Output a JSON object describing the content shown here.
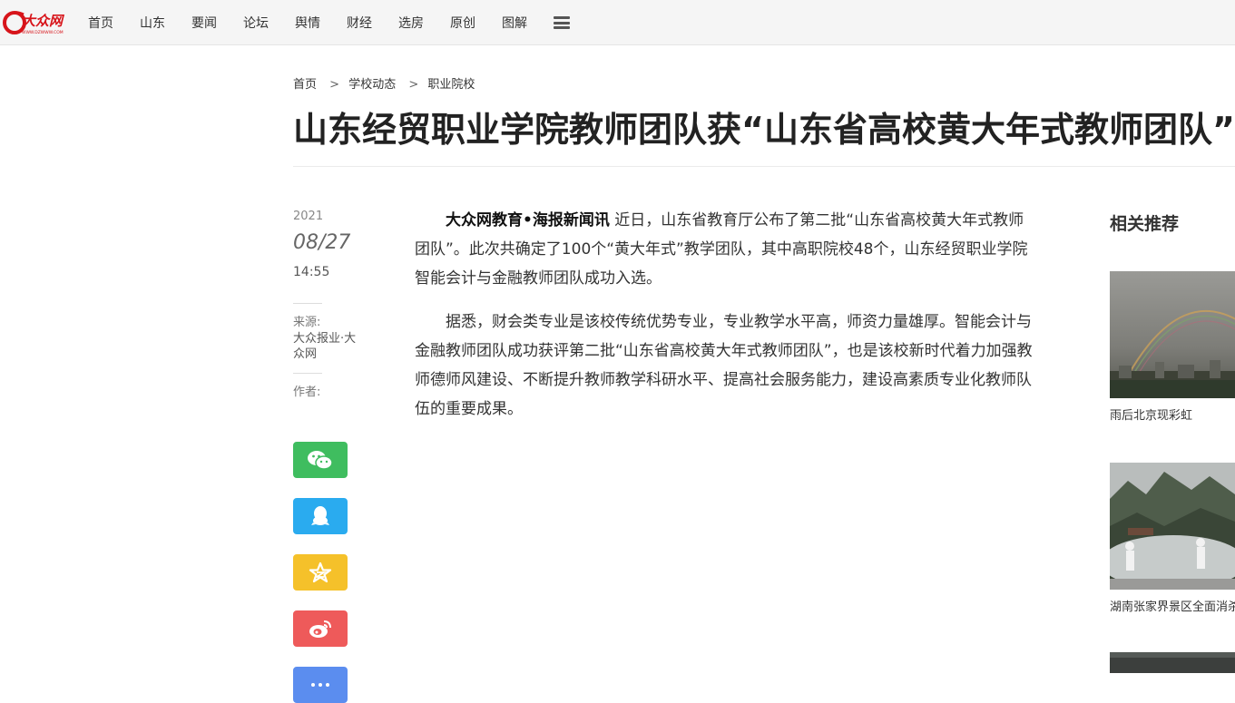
{
  "header": {
    "logo_alt": "大众网",
    "logo_domain": "WWW.DZWWW.COM",
    "nav": [
      "首页",
      "山东",
      "要闻",
      "论坛",
      "舆情",
      "财经",
      "选房",
      "原创",
      "图解"
    ],
    "menu_icon": "hamburger-menu-icon"
  },
  "breadcrumb": {
    "items": [
      "首页",
      "学校动态",
      "职业院校"
    ],
    "separator": ">"
  },
  "article": {
    "title": "山东经贸职业学院教师团队获“山东省高校黄大年式教师团队”",
    "year": "2021",
    "date": "08/27",
    "time": "14:55",
    "source_label": "来源:",
    "source_value": "大众报业·大众网",
    "author_label": "作者:",
    "lead": "大众网教育•海报新闻讯",
    "p1": " 近日，山东省教育厅公布了第二批“山东省高校黄大年式教师团队”。此次共确定了100个“黄大年式”教学团队，其中高职院校48个，山东经贸职业学院智能会计与金融教师团队成功入选。",
    "p2": "据悉，财会类专业是该校传统优势专业，专业教学水平高，师资力量雄厚。智能会计与金融教师团队成功获评第二批“山东省高校黄大年式教师团队”，也是该校新时代着力加强教师德师风建设、不断提升教师教学科研水平、提高社会服务能力，建设高素质专业化教师队伍的重要成果。"
  },
  "share": {
    "buttons": [
      {
        "icon": "wechat-icon",
        "color": "#3fbd5f"
      },
      {
        "icon": "qq-icon",
        "color": "#2aabef"
      },
      {
        "icon": "qzone-star-icon",
        "color": "#f5c12a"
      },
      {
        "icon": "weibo-icon",
        "color": "#ee5a5a"
      },
      {
        "icon": "more-share-icon",
        "color": "#5b8def"
      }
    ]
  },
  "sidebar": {
    "title": "相关推荐",
    "items": [
      {
        "caption": "雨后北京现彩虹"
      },
      {
        "caption": "湖南张家界景区全面消杀"
      }
    ]
  }
}
